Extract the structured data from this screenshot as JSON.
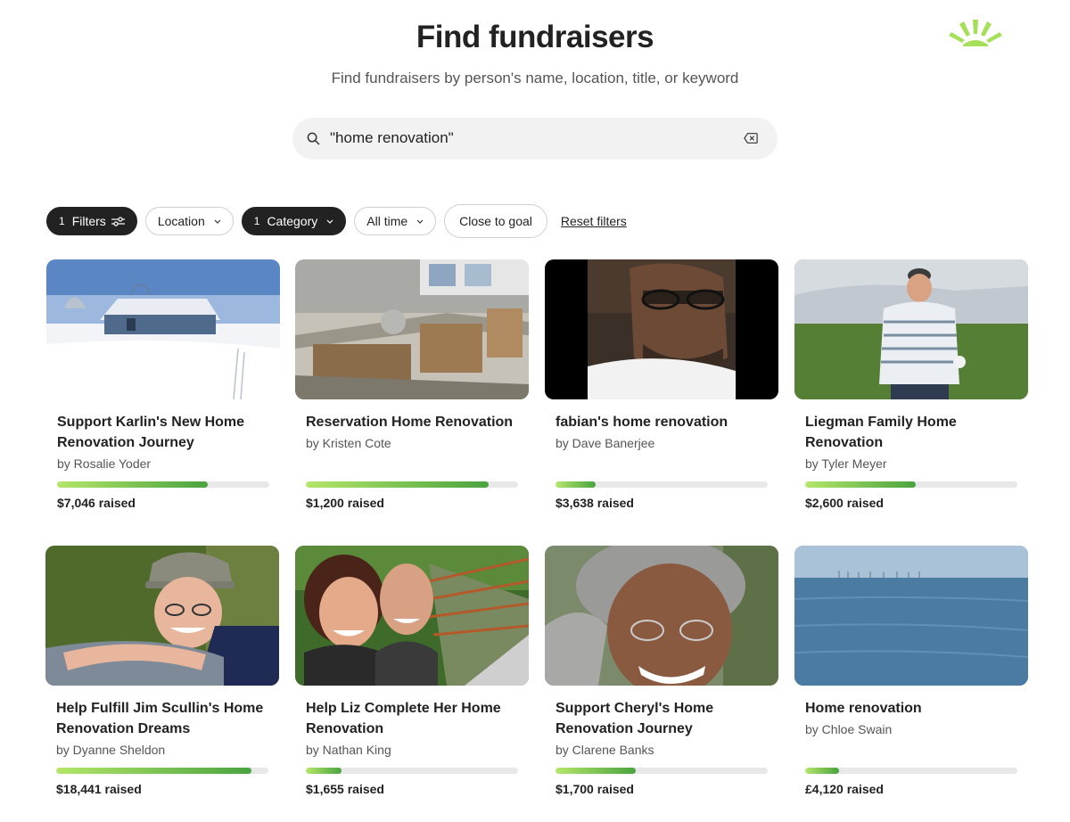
{
  "header": {
    "title": "Find fundraisers",
    "subtitle": "Find fundraisers by person's name, location, title, or keyword"
  },
  "search": {
    "value": "\"home renovation\"",
    "icon": "search-icon",
    "clear_icon": "clear-input-icon"
  },
  "filters": {
    "filters_count": "1",
    "filters_label": "Filters",
    "location_label": "Location",
    "category_count": "1",
    "category_label": "Category",
    "time_label": "All time",
    "close_to_goal_label": "Close to goal",
    "reset_label": "Reset filters"
  },
  "colors": {
    "accent_green": "#4aa340",
    "progress_light": "#b4e66a",
    "chip_dark": "#222222"
  },
  "fundraisers": [
    {
      "title": "Support Karlin's New Home Renovation Journey",
      "organizer": "by Rosalie Yoder",
      "raised": "$7,046 raised",
      "progress": 0.71,
      "image": "snowy farmhouse"
    },
    {
      "title": "Reservation Home Renovation",
      "organizer": "by Kristen Cote",
      "raised": "$1,200 raised",
      "progress": 0.86,
      "image": "gutted kitchen"
    },
    {
      "title": "fabian's home renovation",
      "organizer": "by Dave Banerjee",
      "raised": "$3,638 raised",
      "progress": 0.19,
      "image": "man portrait"
    },
    {
      "title": "Liegman Family Home Renovation",
      "organizer": "by Tyler Meyer",
      "raised": "$2,600 raised",
      "progress": 0.52,
      "image": "man on golf course"
    },
    {
      "title": "Help Fulfill Jim Scullin's Home Renovation Dreams",
      "organizer": "by Dyanne Sheldon",
      "raised": "$18,441 raised",
      "progress": 0.92,
      "image": "smiling man in cap"
    },
    {
      "title": "Help Liz Complete Her Home Renovation",
      "organizer": "by Nathan King",
      "raised": "$1,655 raised",
      "progress": 0.17,
      "image": "couple selfie on bridge"
    },
    {
      "title": "Support Cheryl's Home Renovation Journey",
      "organizer": "by Clarene Banks",
      "raised": "$1,700 raised",
      "progress": 0.38,
      "image": "smiling woman"
    },
    {
      "title": "Home renovation",
      "organizer": "by Chloe Swain",
      "raised": "£4,120 raised",
      "progress": 0.16,
      "image": "sea horizon"
    }
  ]
}
